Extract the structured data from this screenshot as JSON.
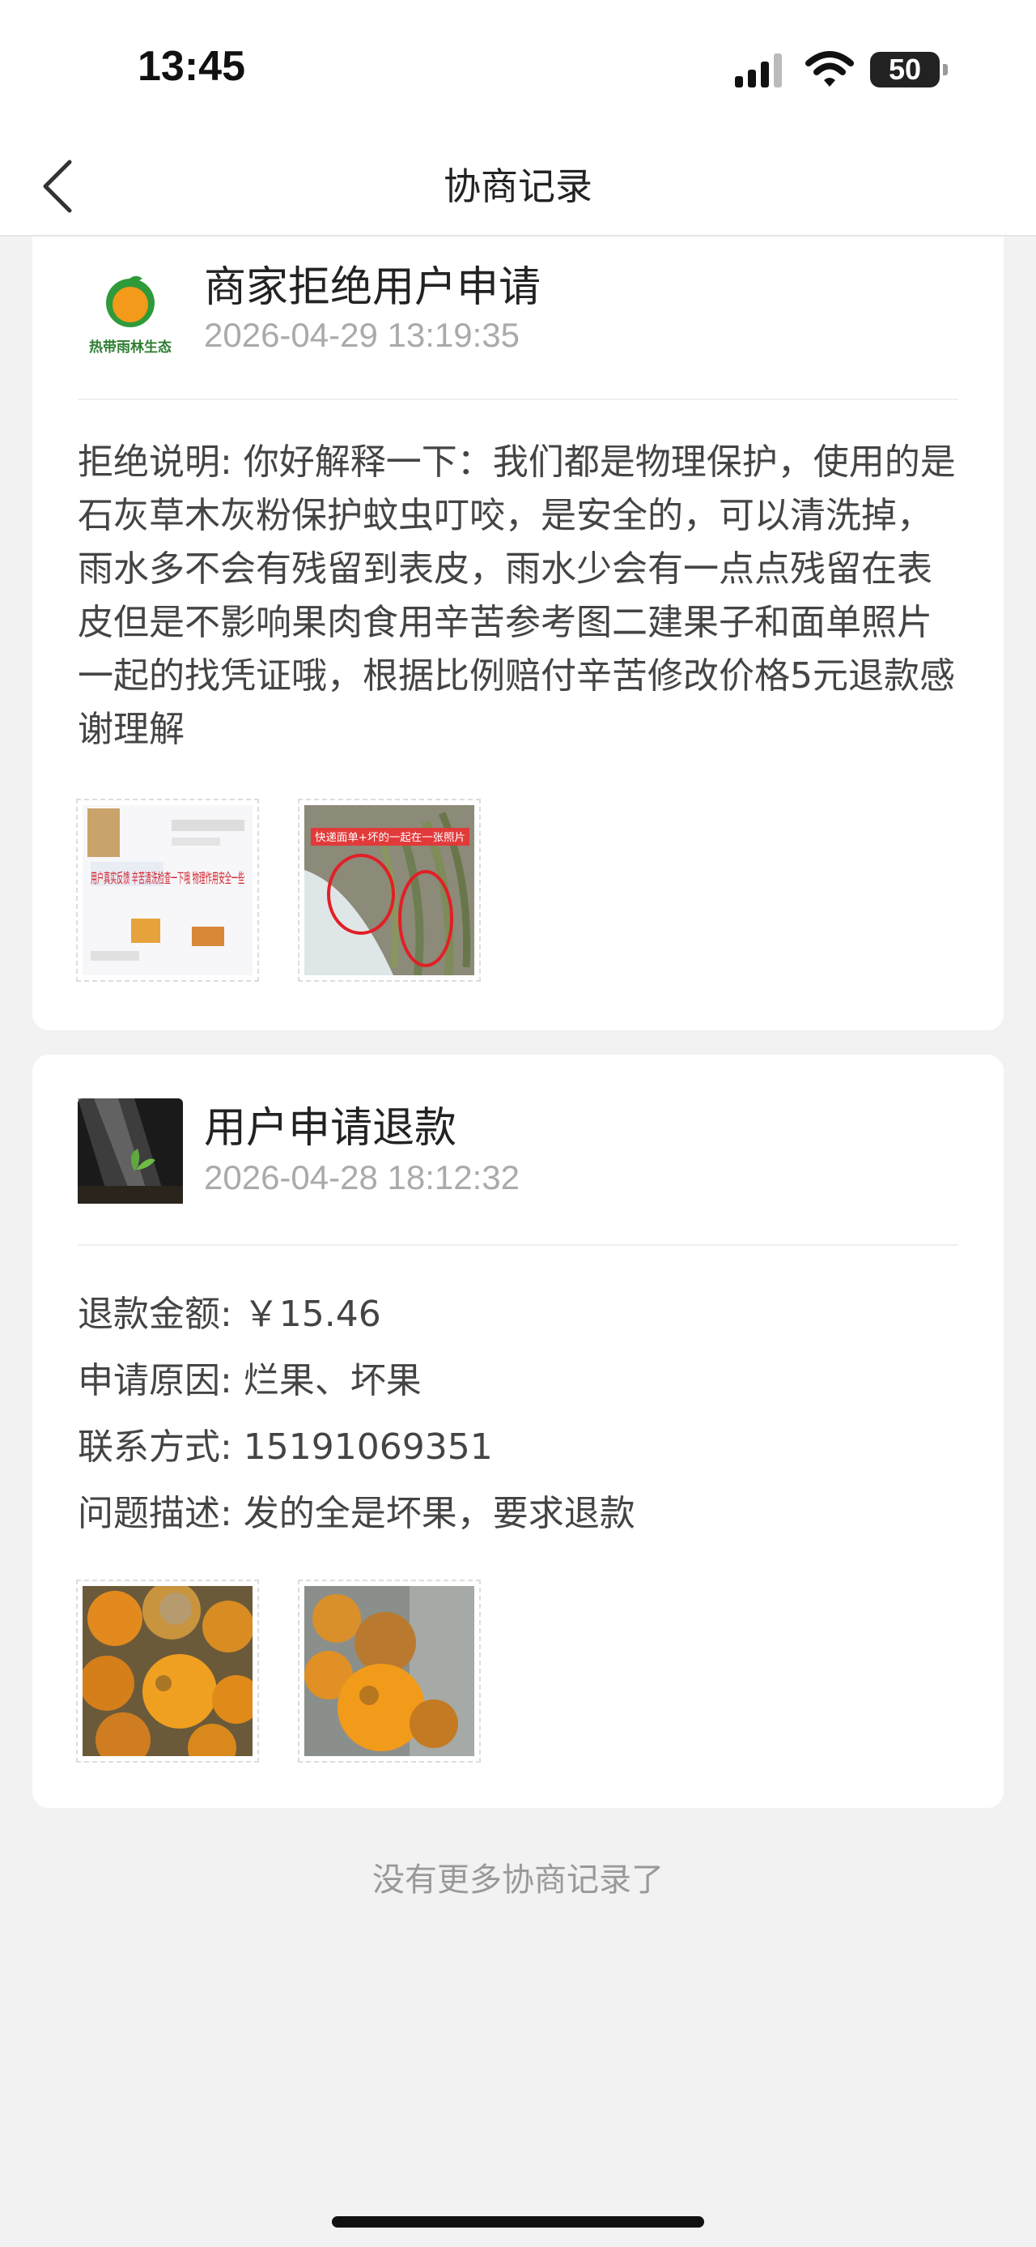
{
  "status_bar": {
    "time": "13:45",
    "battery": "50"
  },
  "navbar": {
    "title": "协商记录"
  },
  "records": [
    {
      "title": "商家拒绝用户申请",
      "time": "2026-04-29 13:19:35",
      "avatar_text": "热带雨林生态",
      "description": "拒绝说明: 你好解释一下：我们都是物理保护，使用的是石灰草木灰粉保护蚊虫叮咬，是安全的，可以清洗掉，雨水多不会有残留到表皮，雨水少会有一点点残留在表皮但是不影响果肉食用辛苦参考图二建果子和面单照片一起的找凭证哦，根据比例赔付辛苦修改价格5元退款感谢理解",
      "images": [
        {
          "name": "chat-screenshot",
          "overlay_text": "用户真实反馈 辛苦清洗检查一下哦 物理作用安全一些"
        },
        {
          "name": "beans-photo",
          "overlay_text": "快递面单+坏的一起在一张照片"
        }
      ]
    },
    {
      "title": "用户申请退款",
      "time": "2026-04-28 18:12:32",
      "details": [
        "退款金额: ￥15.46",
        "申请原因: 烂果、坏果",
        "联系方式: 15191069351",
        "问题描述: 发的全是坏果，要求退款"
      ],
      "images": [
        {
          "name": "oranges-photo-1"
        },
        {
          "name": "oranges-photo-2"
        }
      ]
    }
  ],
  "footer": {
    "no_more": "没有更多协商记录了"
  }
}
